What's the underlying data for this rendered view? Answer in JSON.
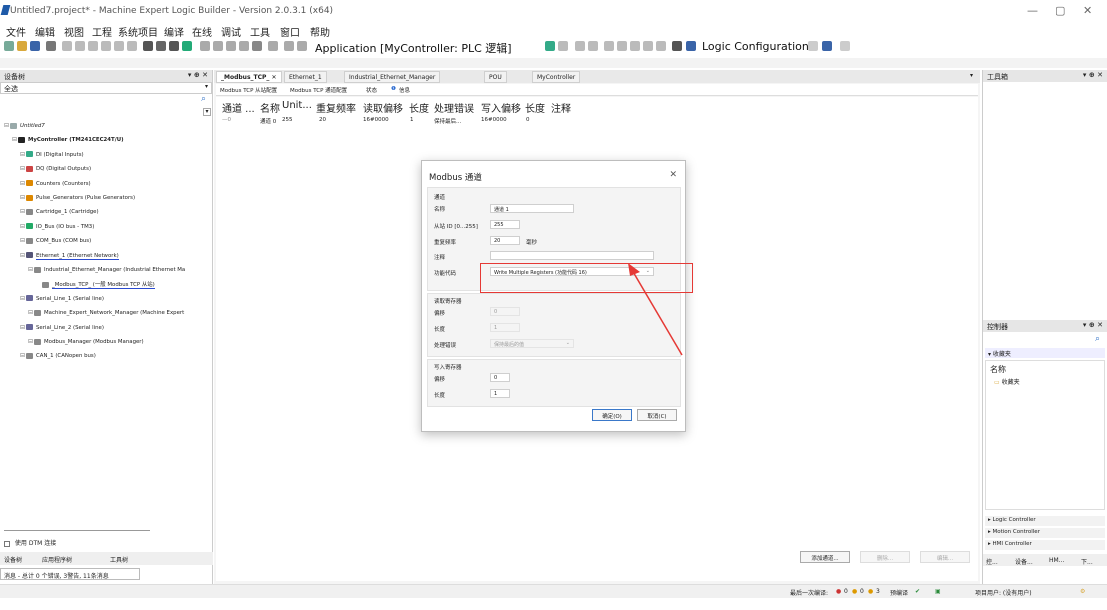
{
  "window": {
    "title": "Untitled7.project* - Machine Expert Logic Builder - Version 2.0.3.1 (x64)",
    "min": "—",
    "max": "▢",
    "close": "✕"
  },
  "menu": [
    "文件",
    "编辑",
    "视图",
    "工程",
    "系统项目",
    "编译",
    "在线",
    "调试",
    "工具",
    "窗口",
    "帮助"
  ],
  "toolbar": {
    "application": "Application [MyController: PLC 逻辑]",
    "logic_config": "Logic Configuration"
  },
  "left": {
    "header": "设备树",
    "ctl": "▾ ⊕ ✕",
    "filter": "全选",
    "tree": [
      {
        "label": "Untitled7",
        "depth": 0,
        "icon": "project-icon",
        "color": "#9aa"
      },
      {
        "label": "MyController (TM241CEC24T/U)",
        "depth": 1,
        "icon": "controller-icon",
        "color": "#222",
        "bold": true
      },
      {
        "label": "DI (Digital Inputs)",
        "depth": 2,
        "icon": "di-icon",
        "color": "#3a8"
      },
      {
        "label": "DQ (Digital Outputs)",
        "depth": 2,
        "icon": "dq-icon",
        "color": "#c44"
      },
      {
        "label": "Counters (Counters)",
        "depth": 2,
        "icon": "counter-icon",
        "color": "#d80"
      },
      {
        "label": "Pulse_Generators (Pulse Generators)",
        "depth": 2,
        "icon": "pulse-icon",
        "color": "#d80"
      },
      {
        "label": "Cartridge_1 (Cartridge)",
        "depth": 2,
        "icon": "cartridge-icon",
        "color": "#888"
      },
      {
        "label": "IO_Bus (IO bus - TM3)",
        "depth": 2,
        "icon": "iobus-icon",
        "color": "#2a6"
      },
      {
        "label": "COM_Bus (COM bus)",
        "depth": 2,
        "icon": "combus-icon",
        "color": "#888"
      },
      {
        "label": "Ethernet_1 (Ethernet Network)",
        "depth": 2,
        "icon": "ethernet-icon",
        "color": "#557",
        "underline": true
      },
      {
        "label": "Industrial_Ethernet_Manager (Industrial Ethernet Ma",
        "depth": 3,
        "icon": "manager-icon",
        "color": "#888"
      },
      {
        "label": "_Modbus_TCP_ (一般 Modbus TCP 从站)",
        "depth": 4,
        "icon": "modbus-icon",
        "color": "#888",
        "underline": true
      },
      {
        "label": "Serial_Line_1 (Serial line)",
        "depth": 2,
        "icon": "serial-icon",
        "color": "#669"
      },
      {
        "label": "Machine_Expert_Network_Manager (Machine Expert",
        "depth": 3,
        "icon": "manager-icon",
        "color": "#888"
      },
      {
        "label": "Serial_Line_2 (Serial line)",
        "depth": 2,
        "icon": "serial-icon",
        "color": "#669"
      },
      {
        "label": "Modbus_Manager (Modbus Manager)",
        "depth": 3,
        "icon": "manager-icon",
        "color": "#888"
      },
      {
        "label": "CAN_1 (CANopen bus)",
        "depth": 2,
        "icon": "can-icon",
        "color": "#888"
      }
    ],
    "dtm": "使用 DTM 连接",
    "bottom_tabs": [
      "设备树",
      "应用程序树",
      "工具树"
    ],
    "messages": "消息 - 总计 0 个错误, 3警告, 11条消息"
  },
  "tabs": [
    "_Modbus_TCP_",
    "Ethernet_1",
    "Industrial_Ethernet_Manager",
    "POU",
    "MyController"
  ],
  "subtabs": [
    "Modbus TCP 从站配置",
    "Modbus TCP 通道配置",
    "状态",
    "信息"
  ],
  "grid": {
    "headers": [
      "通道 ...",
      "名称",
      "Unit...",
      "重复频率",
      "读取偏移",
      "长度",
      "处理错误",
      "写入偏移",
      "长度",
      "注释"
    ],
    "row": [
      "0",
      "通道 0",
      "255",
      "20",
      "16#0000",
      "1",
      "保持最后...",
      "16#0000",
      "0",
      ""
    ]
  },
  "bottom_buttons": [
    "添加通道...",
    "删除...",
    "编辑..."
  ],
  "dialog": {
    "title": "Modbus 通道",
    "close": "✕",
    "section_channel": "通道",
    "name_label": "名称",
    "name_value": "通道 1",
    "slave_label": "从站 ID [0...255]",
    "slave_value": "255",
    "rate_label": "重复频率",
    "rate_value": "20",
    "rate_unit": "毫秒",
    "comment_label": "注释",
    "comment_value": "",
    "func_label": "功能代码",
    "func_value": "Write Multiple Registers (功能代码 16)",
    "section_read": "读取寄存器",
    "read_offset_label": "偏移",
    "read_offset_value": "0",
    "read_len_label": "长度",
    "read_len_value": "1",
    "err_label": "处理错误",
    "err_value": "保持最后的值",
    "section_write": "写入寄存器",
    "write_offset_label": "偏移",
    "write_offset_value": "0",
    "write_len_label": "长度",
    "write_len_value": "1",
    "ok": "确定(O)",
    "cancel": "取消(C)"
  },
  "right": {
    "toolbox": "工具箱",
    "ctl": "▾ ⊕ ✕",
    "controller": "控制器",
    "fav_header": "▾ 收藏夹",
    "name_col": "名称",
    "fav_item": "收藏夹",
    "sections": [
      "▸ Logic Controller",
      "▸ Motion Controller",
      "▸ HMI Controller"
    ],
    "bottom_tabs": [
      "控...",
      "设备...",
      "HM...",
      "下..."
    ]
  },
  "status": {
    "last_build": "最后一次编译:",
    "errors": "0",
    "warnings": "0",
    "msgs": "3",
    "precompile": "预编译",
    "project_user": "项目用户: (没有用户)"
  },
  "colors": {
    "accent": "#1e5aa8",
    "red": "#e53935",
    "grid_header": "#222"
  }
}
